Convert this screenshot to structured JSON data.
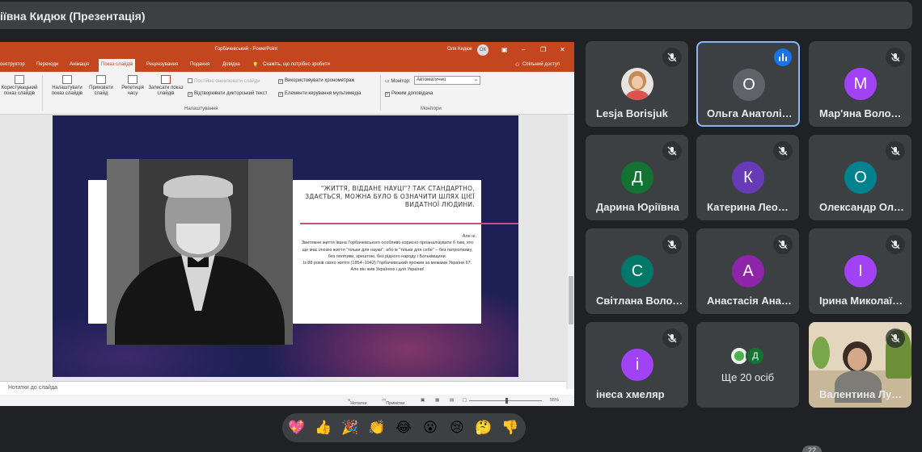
{
  "presenter_bar": {
    "title": "іївна Кидюк (Презентація)"
  },
  "powerpoint": {
    "window_title": "Горбачевський  -  PowerPoint",
    "user_name": "Оля Кидюк",
    "user_initials": "ОК",
    "tabs": [
      "онструктор",
      "Переходи",
      "Анімація",
      "Показ слайдів",
      "Рецензування",
      "Подання",
      "Довідка",
      "Скажіть, що потрібно зробити"
    ],
    "active_tab": "Показ слайдів",
    "share_label": "Спільний доступ",
    "ribbon": {
      "custom_show": "Користувацький показ слайдів",
      "setup_show": "Налаштувати показ слайдів",
      "hide_slide": "Приховати слайд",
      "rehearse": "Репетиція часу",
      "record": "Записати показ слайдів",
      "keep_updated": "Постійно оновлювати слайди",
      "play_narrations": "Відтворювати дикторський текст",
      "use_timings": "Використовувати хронометраж",
      "media_controls": "Елементи керування мультимедіа",
      "monitor_label": "Монітор:",
      "monitor_value": "Автоматично",
      "presenter_view": "Режим доповідача",
      "group_setup": "Налаштування",
      "group_monitors": "Монітори"
    },
    "slide": {
      "heading": "\"ЖИТТЯ, ВІДДАНЕ НАУЦІ\"? ТАК СТАНДАРТНО, ЗДАЄТЬСЯ, МОЖНА БУЛО Б ОЗНАЧИТИ ШЛЯХ ЦІЄЇ ВИДАТНОЇ ЛЮДИНИ.",
      "body_intro": "Але ні.",
      "body_p1": "Звитяжне життя Івана Горбачевського особливо корисно проаналізувати б тим, хто ще має ілюзію життя \"тільки для науки\", або ж \"тільки для себе\" – без патріотизму, без політики, зрештою, без рідного народу і Батьківщини.",
      "body_p2": "Із 88 років свого життя (1854–1942) Горбачевський прожив за межами України 67. Але він жив Україною і для України!"
    },
    "notes_label": "Нотатки до слайда",
    "status": {
      "notes": "Нотатки",
      "comments": "Примітки",
      "zoom": "55%"
    }
  },
  "participants": [
    {
      "name": "Lesja Borisjuk",
      "avatar_letter": "",
      "avatar_color": "#e9e4df",
      "status": "muted"
    },
    {
      "name": "Ольга Анатоліївна Кидюк",
      "avatar_letter": "О",
      "avatar_color": "#5f6368",
      "status": "speaking"
    },
    {
      "name": "Мар'яна Володимирівна",
      "avatar_letter": "М",
      "avatar_color": "#a142f4",
      "status": "muted"
    },
    {
      "name": "Дарина Юріївна",
      "avatar_letter": "Д",
      "avatar_color": "#137333",
      "status": "muted"
    },
    {
      "name": "Катерина Леонтіївна",
      "avatar_letter": "К",
      "avatar_color": "#673ab7",
      "status": "muted"
    },
    {
      "name": "Олександр Олегович",
      "avatar_letter": "О",
      "avatar_color": "#00838f",
      "status": "muted"
    },
    {
      "name": "Світлана Володимирівна",
      "avatar_letter": "С",
      "avatar_color": "#00796b",
      "status": "muted"
    },
    {
      "name": "Анастасія Анатоліївна",
      "avatar_letter": "А",
      "avatar_color": "#8e24aa",
      "status": "muted"
    },
    {
      "name": "Ірина Миколаївна",
      "avatar_letter": "І",
      "avatar_color": "#a142f4",
      "status": "muted"
    },
    {
      "name": "інеса хмеляр",
      "avatar_letter": "і",
      "avatar_color": "#a142f4",
      "status": "muted"
    },
    {
      "name": "Ще 20 осіб",
      "avatar_letter": "Д",
      "avatar_color": "#137333",
      "status": "more"
    },
    {
      "name": "Валентина Лукашенко",
      "avatar_letter": "",
      "avatar_color": "",
      "status": "video-muted"
    }
  ],
  "reactions": [
    "💖",
    "👍",
    "🎉",
    "👏",
    "😂",
    "😮",
    "😢",
    "🤔",
    "👎"
  ],
  "corner_badge": "22",
  "colors": {
    "bg": "#202124",
    "tile": "#3c4043",
    "ppt_accent": "#c4461e",
    "speaking_border": "#8ab4f8"
  }
}
